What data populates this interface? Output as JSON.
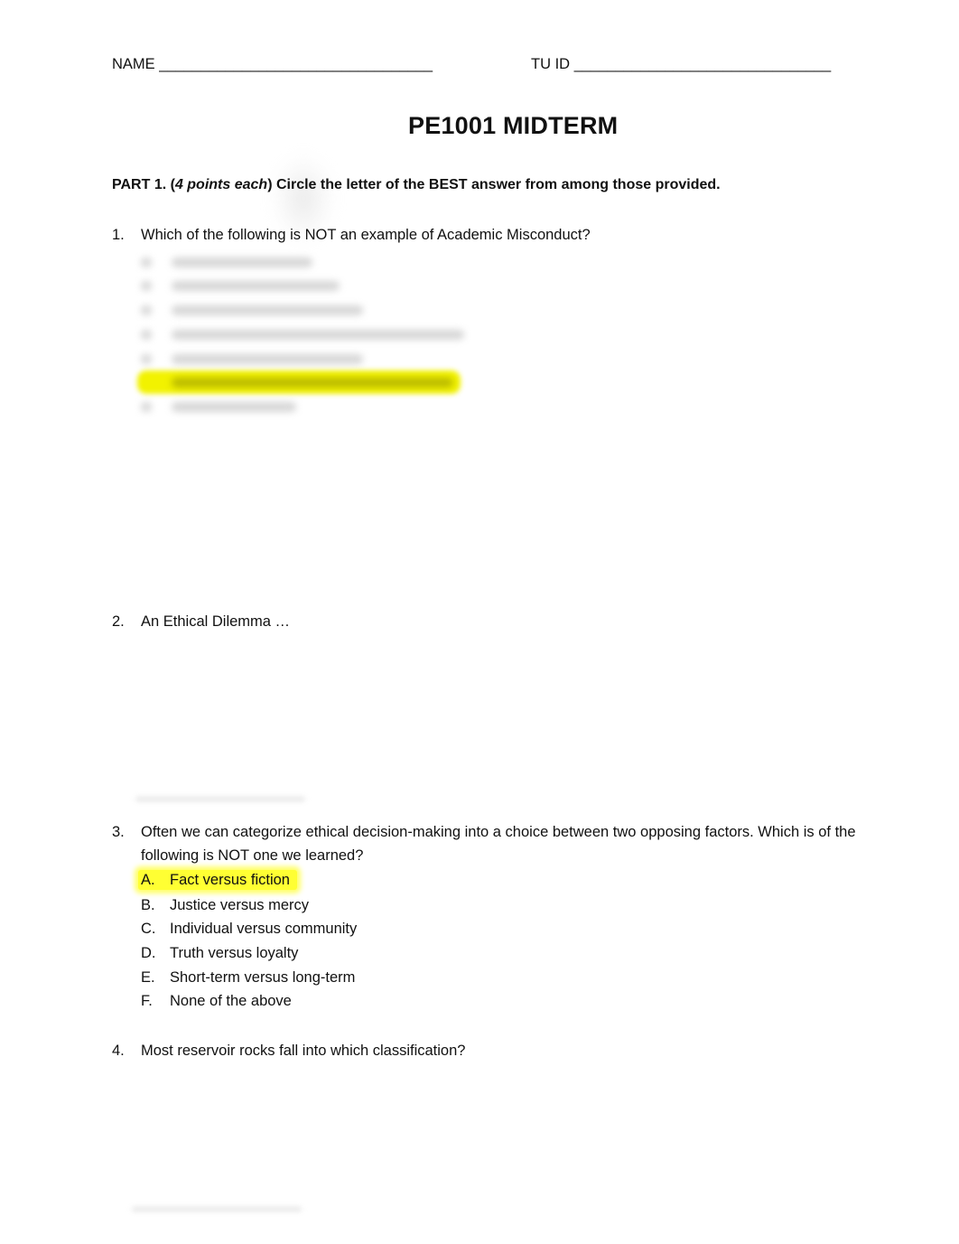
{
  "header": {
    "name_label": "NAME",
    "name_blank": "_________________________________",
    "tuid_label": "TU ID",
    "tuid_blank": "_______________________________"
  },
  "title": "PE1001 MIDTERM",
  "part1": {
    "label": "PART 1. (",
    "points": "4 points each",
    "instruction": ") Circle the letter of the BEST answer from among those provided."
  },
  "questions": [
    {
      "number": "1.",
      "text": "Which of the following is NOT an example of Academic Misconduct?",
      "options_obscured": true,
      "obscured_option_count": 7,
      "highlighted_option_index": 5
    },
    {
      "number": "2.",
      "text": "An Ethical Dilemma …"
    },
    {
      "number": "3.",
      "text_line1": "Often we can categorize ethical decision-making into a choice between two opposing factors. Which is of the",
      "text_line2": "following is NOT one we learned?",
      "options": [
        {
          "letter": "A.",
          "text": "Fact versus fiction",
          "highlighted": true
        },
        {
          "letter": "B.",
          "text": "Justice versus mercy",
          "highlighted": false
        },
        {
          "letter": "C.",
          "text": "Individual versus community",
          "highlighted": false
        },
        {
          "letter": "D.",
          "text": "Truth versus loyalty",
          "highlighted": false
        },
        {
          "letter": "E.",
          "text": "Short-term versus long-term",
          "highlighted": false
        },
        {
          "letter": "F.",
          "text": "None of the above",
          "highlighted": false
        }
      ]
    },
    {
      "number": "4.",
      "text": "Most reservoir rocks fall into which classification?"
    }
  ],
  "colors": {
    "highlight": "#ffff33",
    "text": "#111111"
  }
}
